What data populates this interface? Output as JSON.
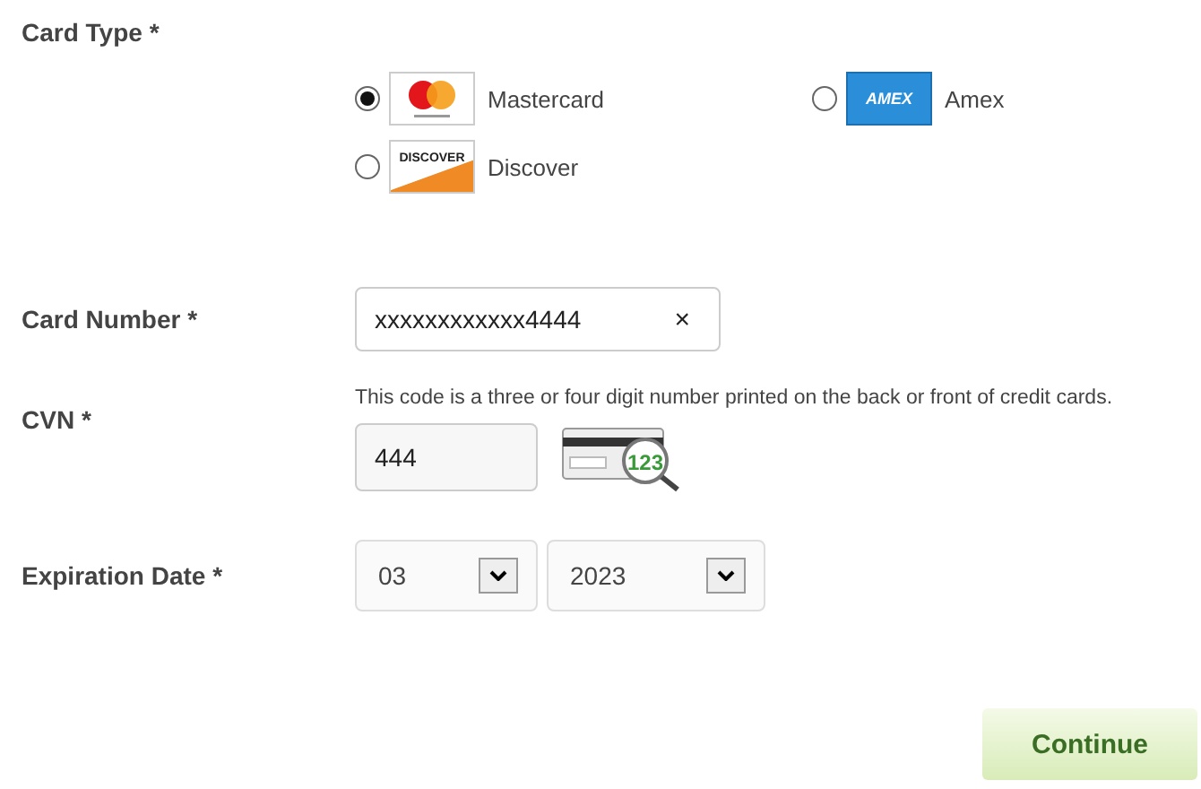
{
  "card_type": {
    "label": "Card Type *",
    "options": [
      {
        "kind": "mastercard",
        "label": "Mastercard",
        "selected": true
      },
      {
        "kind": "amex",
        "label": "Amex",
        "logo_text": "AMEX",
        "selected": false
      },
      {
        "kind": "discover",
        "label": "Discover",
        "logo_text": "DISCOVER",
        "selected": false
      }
    ]
  },
  "card_number": {
    "label": "Card Number *",
    "value": "xxxxxxxxxxxx4444",
    "clear": "×"
  },
  "cvn": {
    "label": "CVN *",
    "help": "This code is a three or four digit number printed on the back or front of credit cards.",
    "value": "444",
    "icon_text": "123"
  },
  "expiration": {
    "label": "Expiration Date *",
    "month": "03",
    "year": "2023"
  },
  "continue_button": "Continue"
}
